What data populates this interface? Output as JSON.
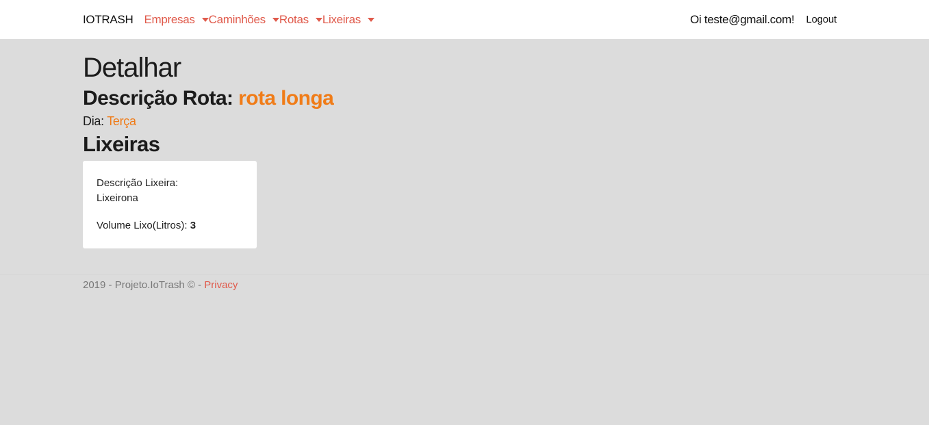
{
  "navbar": {
    "brand": "IOTRASH",
    "items": [
      {
        "label": "Empresas"
      },
      {
        "label": "Caminhões"
      },
      {
        "label": "Rotas"
      },
      {
        "label": "Lixeiras"
      }
    ],
    "greeting": "Oi teste@gmail.com!",
    "logout": "Logout"
  },
  "main": {
    "title": "Detalhar",
    "route_label": "Descrição Rota:",
    "route_value": "rota longa",
    "day_label": "Dia:",
    "day_value": "Terça",
    "section_title": "Lixeiras",
    "bins": [
      {
        "desc_label": "Descrição Lixeira:",
        "desc_value": "Lixeirona",
        "volume_label": "Volume Lixo(Litros):",
        "volume_value": "3"
      }
    ]
  },
  "footer": {
    "text": "2019 - Projeto.IoTrash © - ",
    "privacy": "Privacy"
  },
  "colors": {
    "accent": "#e05a4b",
    "highlight": "#f07c18",
    "background": "#dcdcdc"
  }
}
